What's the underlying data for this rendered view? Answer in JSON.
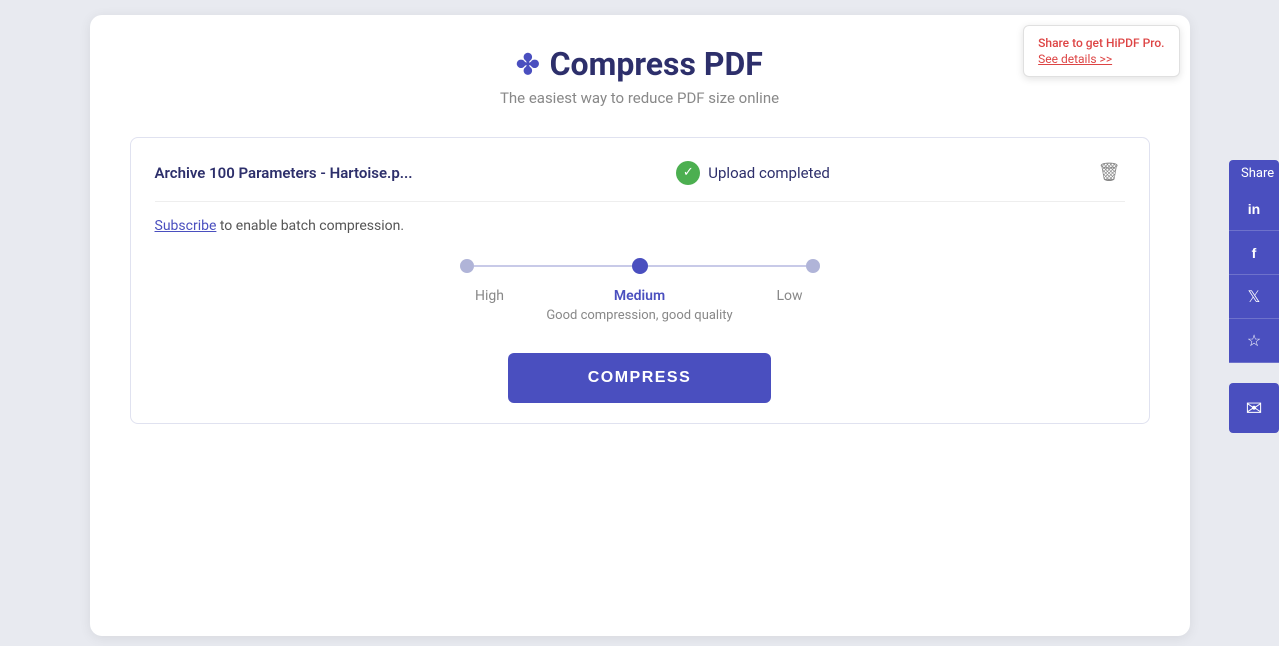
{
  "header": {
    "title": "Compress PDF",
    "subtitle": "The easiest way to reduce PDF size online"
  },
  "tooltip": {
    "main_text": "Share to get HiPDF Pro.",
    "link_text": "See details >>"
  },
  "file": {
    "name": "Archive 100 Parameters - Hartoise.p...",
    "status": "Upload completed"
  },
  "subscribe": {
    "link_text": "Subscribe",
    "description": " to enable batch compression."
  },
  "compression": {
    "options": [
      {
        "label": "High",
        "active": false
      },
      {
        "label": "Medium",
        "active": true
      },
      {
        "label": "Low",
        "active": false
      }
    ],
    "description": "Good compression, good quality"
  },
  "compress_button": {
    "label": "COMPRESS"
  },
  "share": {
    "label": "Share",
    "buttons": [
      {
        "icon": "in",
        "name": "linkedin"
      },
      {
        "icon": "f",
        "name": "facebook"
      },
      {
        "icon": "🐦",
        "name": "twitter"
      },
      {
        "icon": "☆",
        "name": "bookmark"
      }
    ],
    "mail_icon": "✉"
  }
}
